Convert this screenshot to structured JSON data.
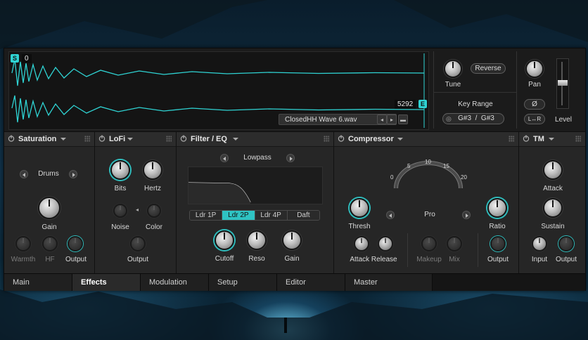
{
  "sample": {
    "start_marker": "S",
    "start_value": "0",
    "end_marker": "E",
    "end_value": "5292",
    "file_name": "ClosedHH Wave 6.wav",
    "tune_label": "Tune",
    "reverse_label": "Reverse",
    "key_range_label": "Key Range",
    "key_range_value": "G#3  /  G#3",
    "pan_label": "Pan",
    "phase_label": "Ø",
    "stereo_label": "L↔R",
    "level_label": "Level",
    "accent_color": "#2fd3d3"
  },
  "saturation": {
    "title": "Saturation",
    "mode": "Drums",
    "gain_label": "Gain",
    "warmth_label": "Warmth",
    "hf_label": "HF",
    "output_label": "Output"
  },
  "lofi": {
    "title": "LoFi",
    "bits_label": "Bits",
    "hertz_label": "Hertz",
    "noise_label": "Noise",
    "color_label": "Color",
    "output_label": "Output"
  },
  "filter": {
    "title": "Filter / EQ",
    "type": "Lowpass",
    "modes": [
      "Ldr 1P",
      "Ldr 2P",
      "Ldr 4P",
      "Daft"
    ],
    "active_mode": "Ldr 2P",
    "cutoff_label": "Cutoff",
    "reso_label": "Reso",
    "gain_label": "Gain"
  },
  "compressor": {
    "title": "Compressor",
    "meter_ticks": [
      "0",
      "5",
      "10",
      "15",
      "20"
    ],
    "mode": "Pro",
    "thresh_label": "Thresh",
    "ratio_label": "Ratio",
    "attack_release_label": "Attack Release",
    "makeup_label": "Makeup",
    "mix_label": "Mix",
    "output_label": "Output"
  },
  "tm": {
    "title": "TM",
    "attack_label": "Attack",
    "sustain_label": "Sustain",
    "input_label": "Input",
    "output_label": "Output"
  },
  "tabs": [
    "Main",
    "Effects",
    "Modulation",
    "Setup",
    "Editor",
    "Master"
  ],
  "active_tab": "Effects"
}
